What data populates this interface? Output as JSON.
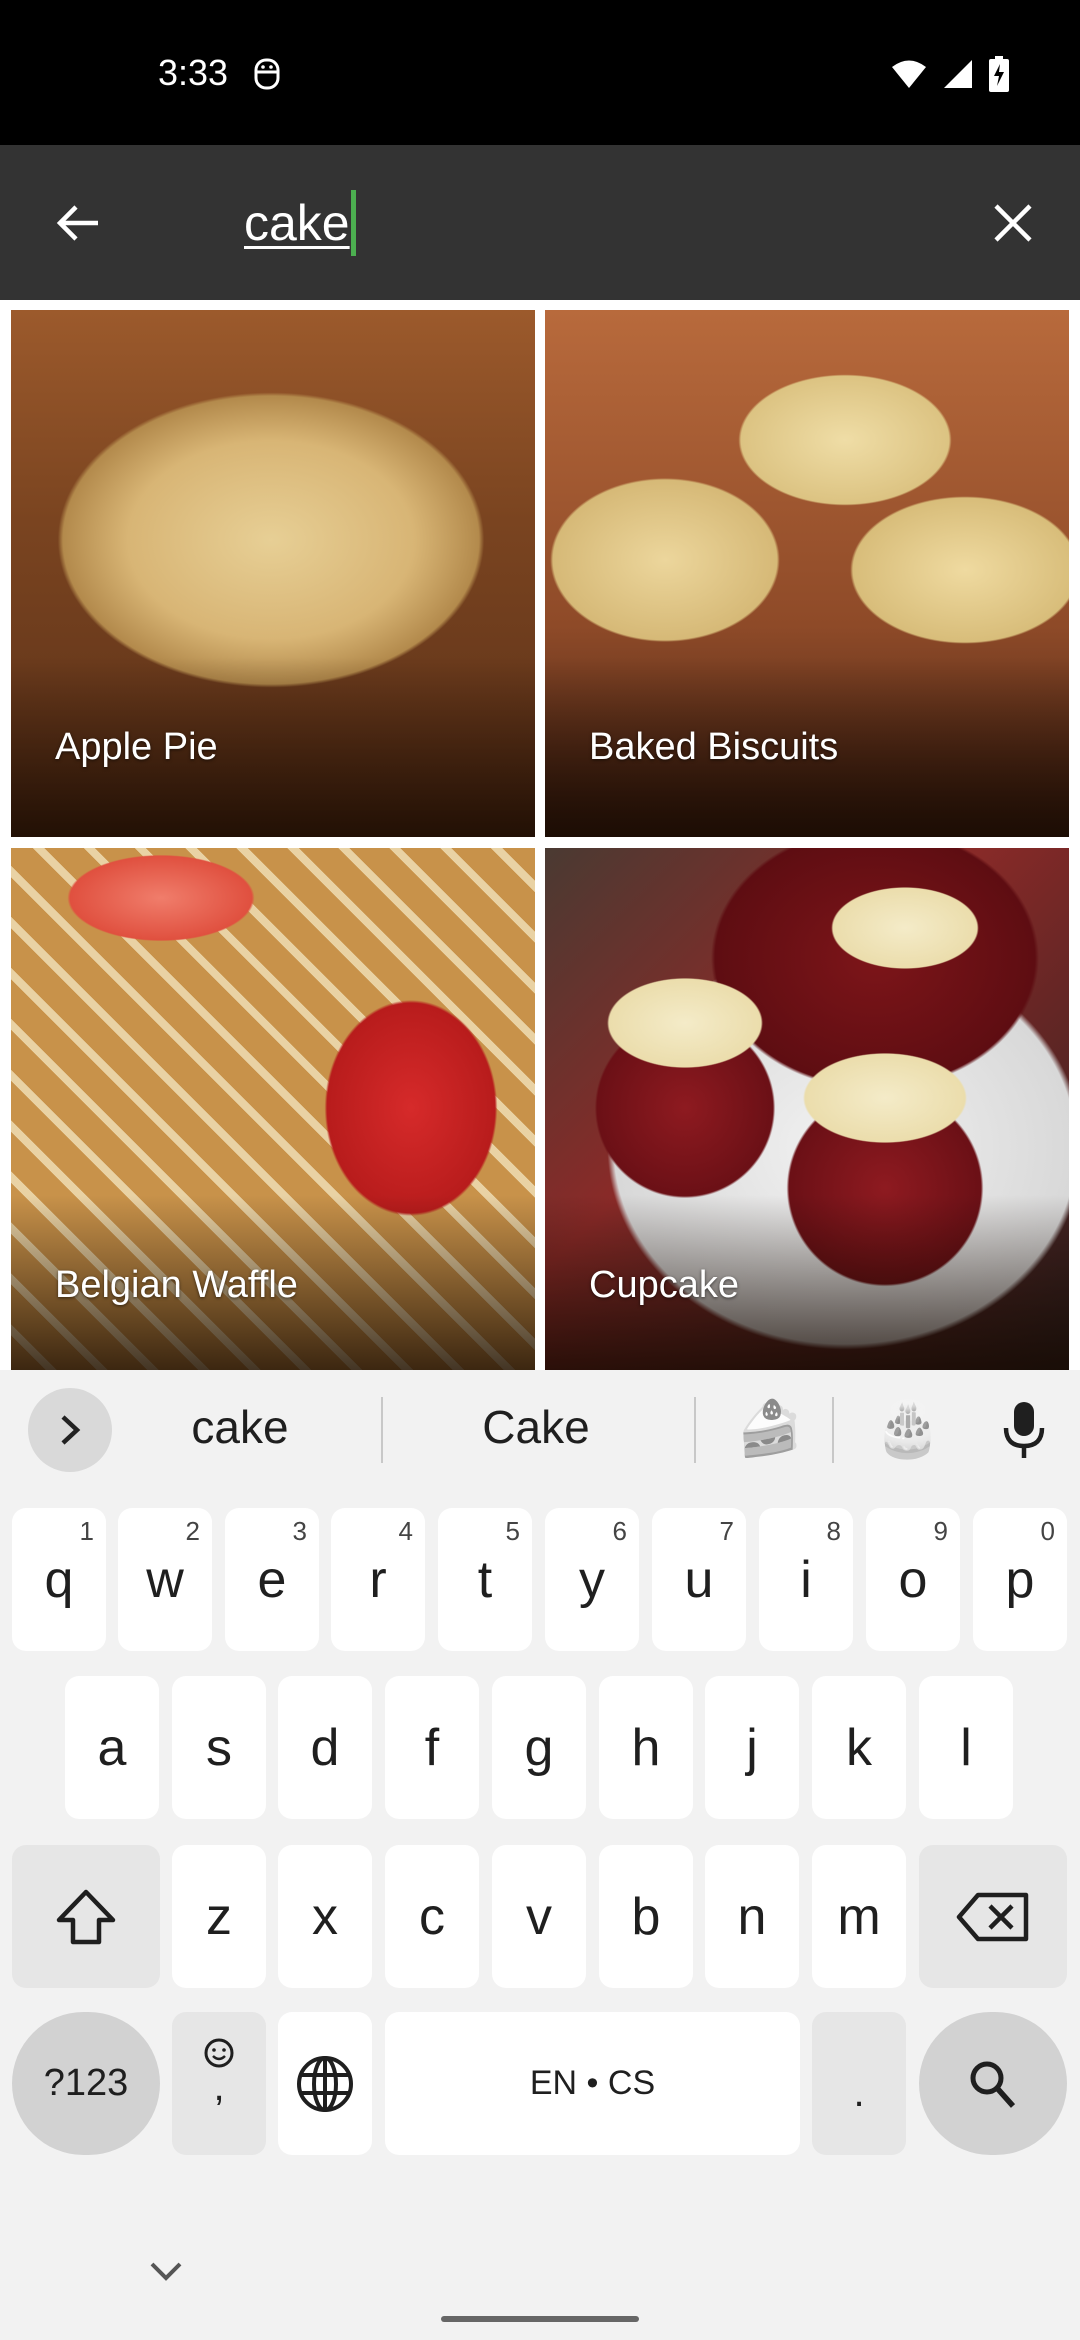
{
  "status_bar": {
    "time": "3:33",
    "icons": [
      "vpn-icon",
      "wifi-icon",
      "signal-icon",
      "battery-charging-icon"
    ]
  },
  "search": {
    "query": "cake",
    "back_icon": "arrow-back-icon",
    "clear_icon": "close-icon",
    "caret_color": "#4caf50"
  },
  "results": [
    {
      "label": "Apple Pie"
    },
    {
      "label": "Baked Biscuits"
    },
    {
      "label": "Belgian Waffle"
    },
    {
      "label": "Cupcake"
    }
  ],
  "keyboard": {
    "suggestions": [
      "cake",
      "Cake"
    ],
    "emoji_suggestions": [
      "🍰",
      "🎂"
    ],
    "row1": [
      {
        "key": "q",
        "hint": "1"
      },
      {
        "key": "w",
        "hint": "2"
      },
      {
        "key": "e",
        "hint": "3"
      },
      {
        "key": "r",
        "hint": "4"
      },
      {
        "key": "t",
        "hint": "5"
      },
      {
        "key": "y",
        "hint": "6"
      },
      {
        "key": "u",
        "hint": "7"
      },
      {
        "key": "i",
        "hint": "8"
      },
      {
        "key": "o",
        "hint": "9"
      },
      {
        "key": "p",
        "hint": "0"
      }
    ],
    "row2": [
      "a",
      "s",
      "d",
      "f",
      "g",
      "h",
      "j",
      "k",
      "l"
    ],
    "row3": [
      "z",
      "x",
      "c",
      "v",
      "b",
      "n",
      "m"
    ],
    "symbols_label": "?123",
    "comma_label": ",",
    "space_label": "EN • CS",
    "period_label": "."
  }
}
